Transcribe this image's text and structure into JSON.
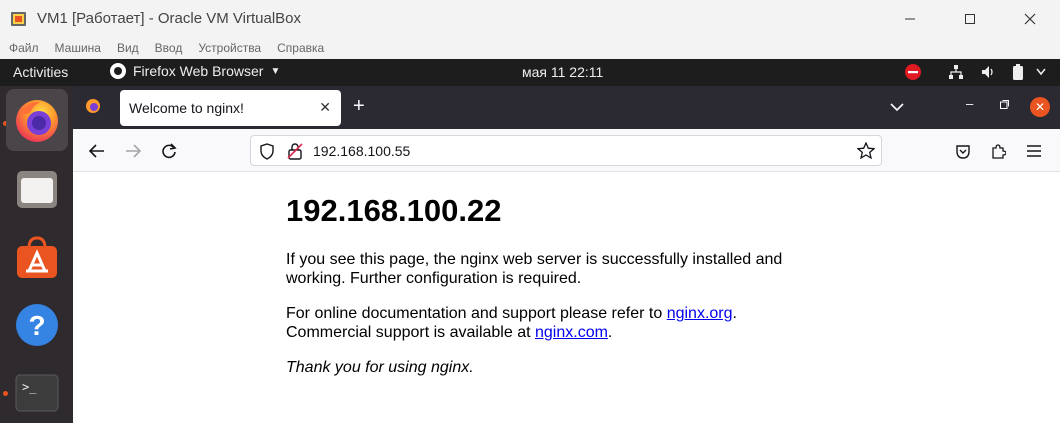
{
  "vbox": {
    "title": "VM1 [Работает] - Oracle VM VirtualBox",
    "menu": [
      "Файл",
      "Машина",
      "Вид",
      "Ввод",
      "Устройства",
      "Справка"
    ]
  },
  "gnome": {
    "activities": "Activities",
    "app_name": "Firefox Web Browser",
    "clock": "мая 11  22:11"
  },
  "dock": {
    "items": [
      "firefox-icon",
      "files-icon",
      "app-center-icon",
      "help-icon",
      "terminal-icon"
    ],
    "accent": "#e95420"
  },
  "firefox": {
    "tab_title": "Welcome to nginx!",
    "url": "192.168.100.55"
  },
  "page": {
    "heading": "192.168.100.22",
    "p1": "If you see this page, the nginx web server is successfully installed and working. Further configuration is required.",
    "p2_prefix": "For online documentation and support please refer to ",
    "link1": "nginx.org",
    "p2_mid": ".",
    "p2_line2": "Commercial support is available at ",
    "link2": "nginx.com",
    "p2_end": ".",
    "p3": "Thank you for using nginx."
  }
}
